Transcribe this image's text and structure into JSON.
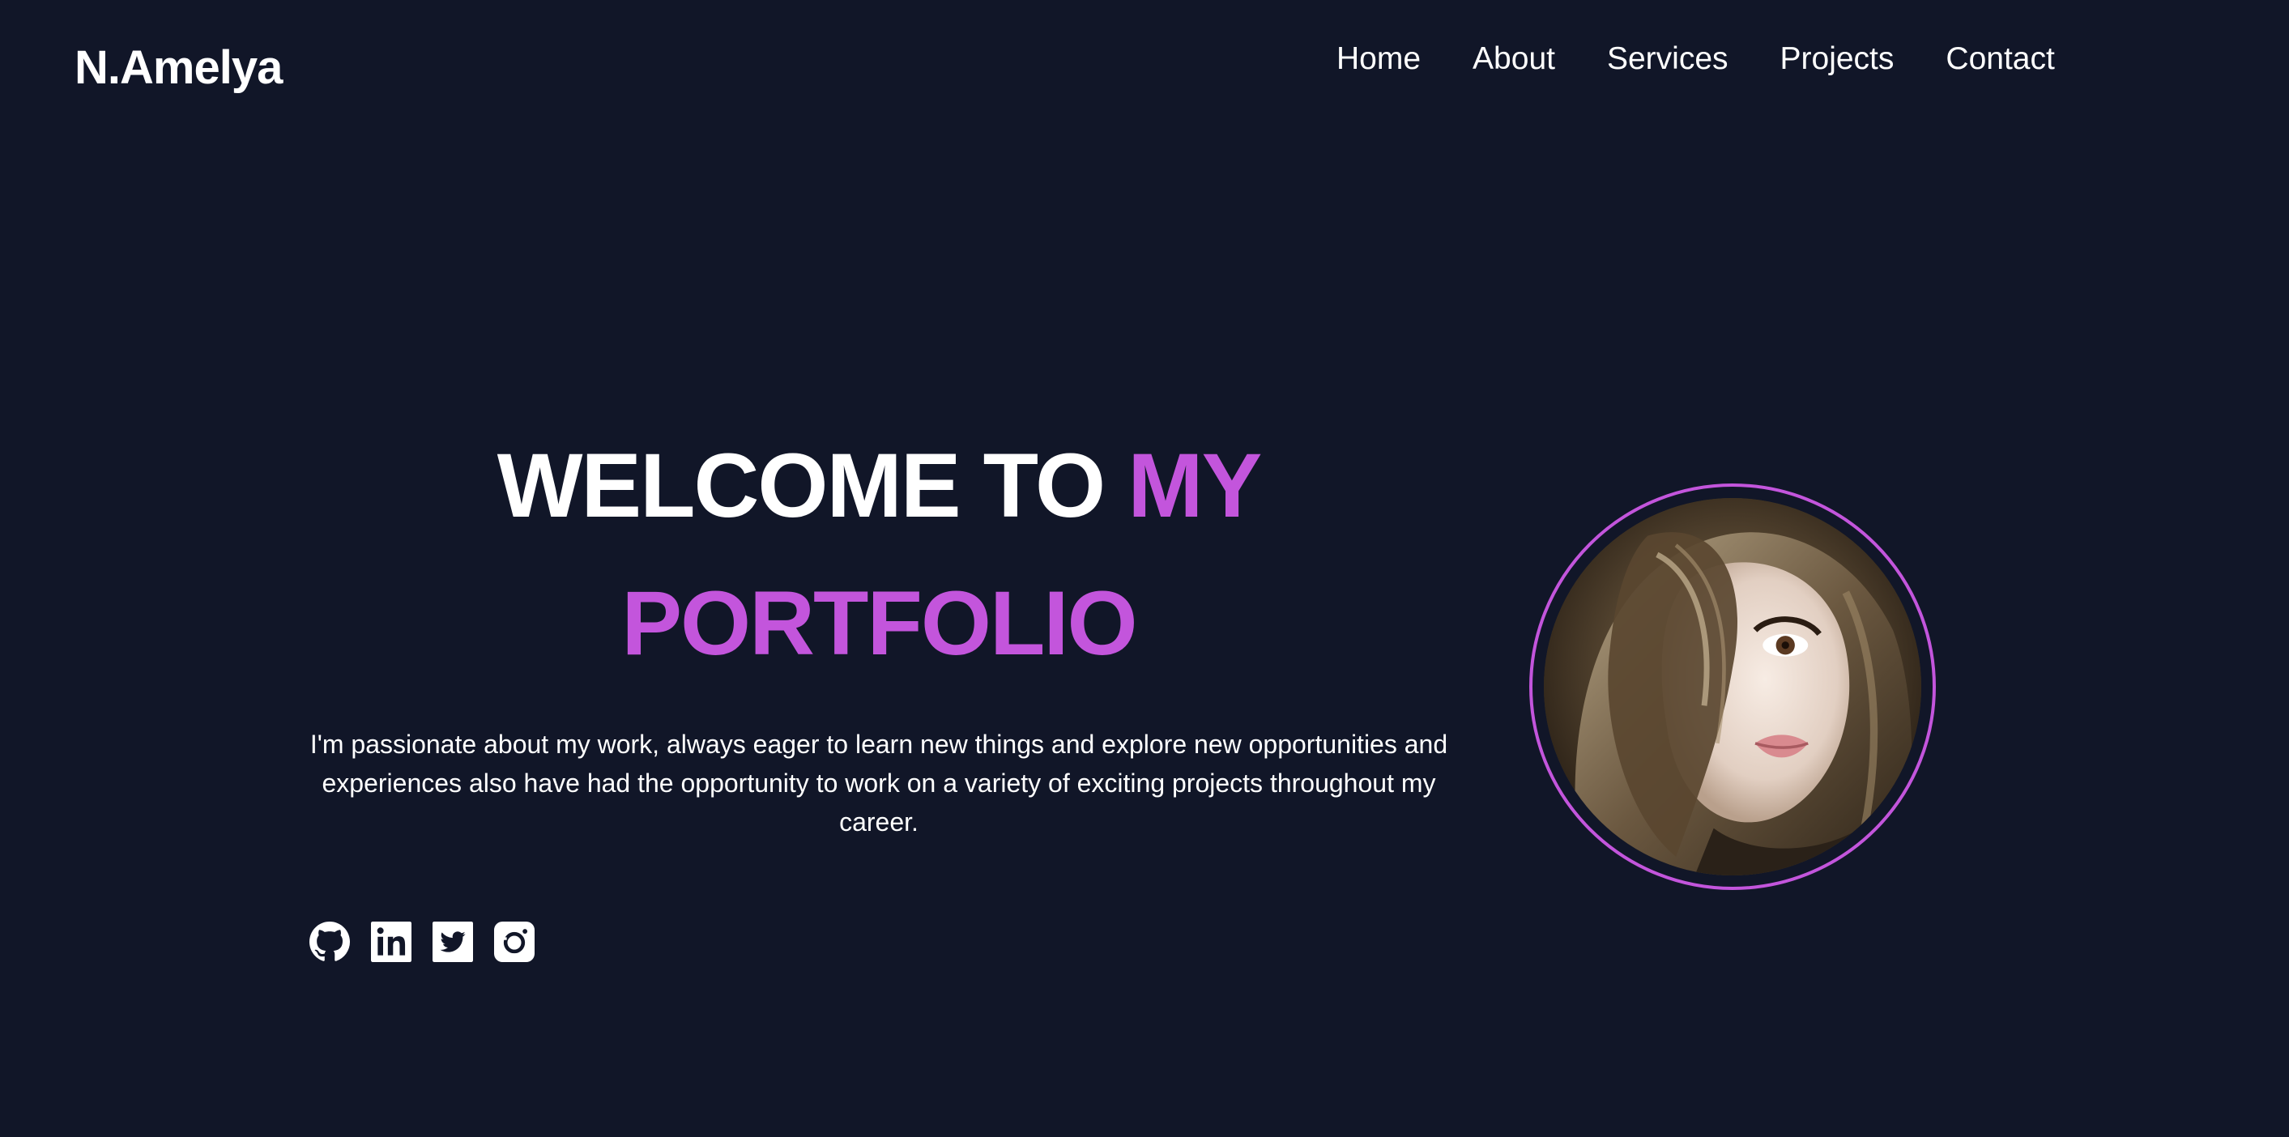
{
  "header": {
    "logo": "N.Amelya",
    "nav": [
      {
        "label": "Home"
      },
      {
        "label": "About"
      },
      {
        "label": "Services"
      },
      {
        "label": "Projects"
      },
      {
        "label": "Contact"
      }
    ]
  },
  "hero": {
    "title_white": "WELCOME TO",
    "title_accent_1": "MY",
    "title_accent_2": "PORTFOLIO",
    "description": "I'm passionate about my work, always eager to learn new things and explore new opportunities and experiences also have had the opportunity to work on a variety of exciting projects throughout my career.",
    "socials": [
      {
        "icon": "github-icon"
      },
      {
        "icon": "linkedin-icon"
      },
      {
        "icon": "twitter-icon"
      },
      {
        "icon": "instagram-icon"
      }
    ]
  },
  "colors": {
    "background": "#111628",
    "accent": "#c355dc",
    "text": "#ffffff"
  }
}
